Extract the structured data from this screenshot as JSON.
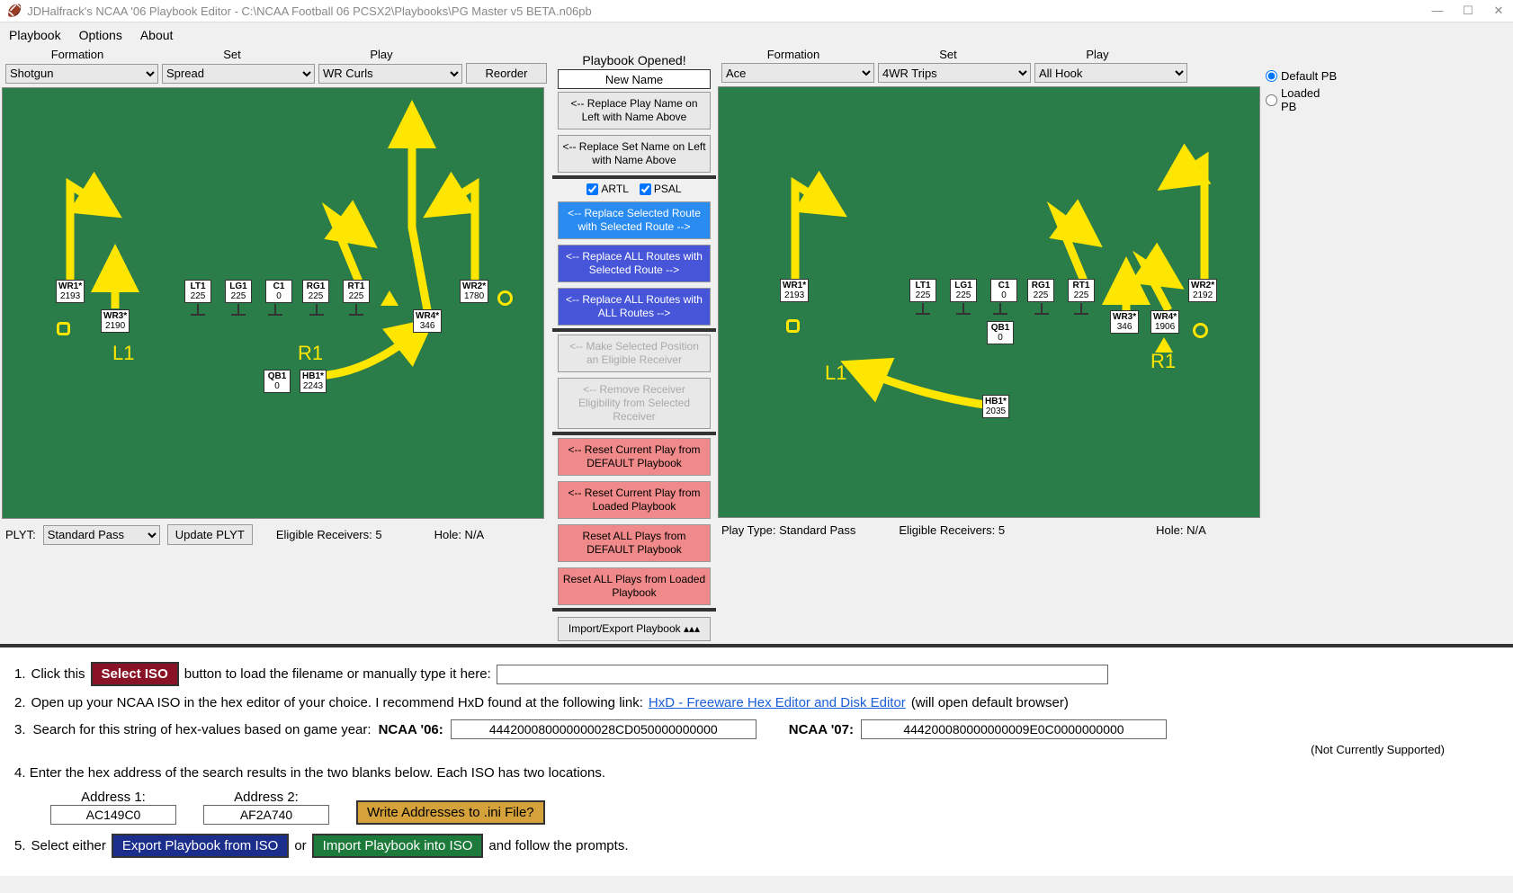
{
  "window": {
    "title": "JDHalfrack's NCAA '06 Playbook Editor - C:\\NCAA Football 06 PCSX2\\Playbooks\\PG Master v5 BETA.n06pb",
    "min": "—",
    "max": "☐",
    "close": "✕"
  },
  "menu": {
    "playbook": "Playbook",
    "options": "Options",
    "about": "About"
  },
  "labels": {
    "formation": "Formation",
    "set": "Set",
    "play": "Play",
    "reorder": "Reorder"
  },
  "left": {
    "formation": "Shotgun",
    "set": "Spread",
    "play": "WR Curls",
    "plyt_label": "PLYT:",
    "plyt_value": "Standard Pass",
    "update_plyt": "Update PLYT",
    "elig": "Eligible Receivers: 5",
    "hole": "Hole: N/A",
    "annot": {
      "L1": "L1",
      "R1": "R1"
    },
    "players": {
      "WR1": {
        "t": "WR1*",
        "n": "2193"
      },
      "WR3": {
        "t": "WR3*",
        "n": "2190"
      },
      "LT1": {
        "t": "LT1",
        "n": "225"
      },
      "LG1": {
        "t": "LG1",
        "n": "225"
      },
      "C1": {
        "t": "C1",
        "n": "0"
      },
      "RG1": {
        "t": "RG1",
        "n": "225"
      },
      "RT1": {
        "t": "RT1",
        "n": "225"
      },
      "WR4": {
        "t": "WR4*",
        "n": "346"
      },
      "WR2": {
        "t": "WR2*",
        "n": "1780"
      },
      "QB1": {
        "t": "QB1",
        "n": "0"
      },
      "HB1": {
        "t": "HB1*",
        "n": "2243"
      }
    }
  },
  "center": {
    "opened": "Playbook Opened!",
    "new_name": "New Name",
    "replace_play_name": "<-- Replace Play Name on Left with Name Above",
    "replace_set_name": "<-- Replace Set Name on Left with Name Above",
    "chk_artl": "ARTL",
    "chk_psal": "PSAL",
    "replace_selected_route": "<-- Replace Selected Route with Selected Route -->",
    "replace_all_selected": "<-- Replace ALL Routes with Selected Route -->",
    "replace_all_all": "<-- Replace ALL Routes with ALL Routes -->",
    "make_eligible": "<-- Make Selected Position an Eligible Receiver",
    "remove_elig": "<-- Remove Receiver Eligibility from Selected Receiver",
    "reset_default": "<-- Reset Current Play from DEFAULT Playbook",
    "reset_loaded": "<-- Reset Current Play from Loaded Playbook",
    "reset_all_default": "Reset ALL Plays from DEFAULT Playbook",
    "reset_all_loaded": "Reset ALL Plays from Loaded Playbook",
    "import_export": "Import/Export Playbook ▴▴▴"
  },
  "right": {
    "formation": "Ace",
    "set": "4WR Trips",
    "play": "All Hook",
    "default_pb": "Default PB",
    "loaded_pb": "Loaded PB",
    "playtype": "Play Type: Standard Pass",
    "elig": "Eligible Receivers: 5",
    "hole": "Hole: N/A",
    "annot": {
      "L1": "L1",
      "R1": "R1"
    },
    "players": {
      "WR1": {
        "t": "WR1*",
        "n": "2193"
      },
      "LT1": {
        "t": "LT1",
        "n": "225"
      },
      "LG1": {
        "t": "LG1",
        "n": "225"
      },
      "C1": {
        "t": "C1",
        "n": "0"
      },
      "RG1": {
        "t": "RG1",
        "n": "225"
      },
      "RT1": {
        "t": "RT1",
        "n": "225"
      },
      "WR3": {
        "t": "WR3*",
        "n": "346"
      },
      "WR4": {
        "t": "WR4*",
        "n": "1906"
      },
      "WR2": {
        "t": "WR2*",
        "n": "2192"
      },
      "QB1": {
        "t": "QB1",
        "n": "0"
      },
      "HB1": {
        "t": "HB1*",
        "n": "2035"
      }
    }
  },
  "instructions": {
    "s1a": "Click this ",
    "s1btn": "Select ISO",
    "s1b": " button to load the filename or manually type it here:",
    "s2a": "Open up your NCAA ISO in the hex editor of your choice.  I recommend HxD found at the following link:  ",
    "s2link": "HxD - Freeware Hex Editor and Disk Editor",
    "s2b": " (will open default browser)",
    "s3a": "Search for this string of hex-values based on game year:  ",
    "s3n06": "NCAA '06:",
    "s3v06": "444200080000000028CD050000000000",
    "s3n07": "NCAA '07:",
    "s3v07": "444200080000000009E0C0000000000",
    "s3note": "(Not Currently Supported)",
    "s4": "Enter the hex address of the search results in the two blanks below.  Each ISO has two locations.",
    "addr1_label": "Address 1:",
    "addr2_label": "Address 2:",
    "addr1": "AC149C0",
    "addr2": "AF2A740",
    "writebtn": "Write Addresses to .ini File?",
    "s5a": "Select either ",
    "s5export": "Export Playbook from ISO",
    "s5or": " or ",
    "s5import": "Import Playbook into ISO",
    "s5b": " and follow the prompts."
  }
}
